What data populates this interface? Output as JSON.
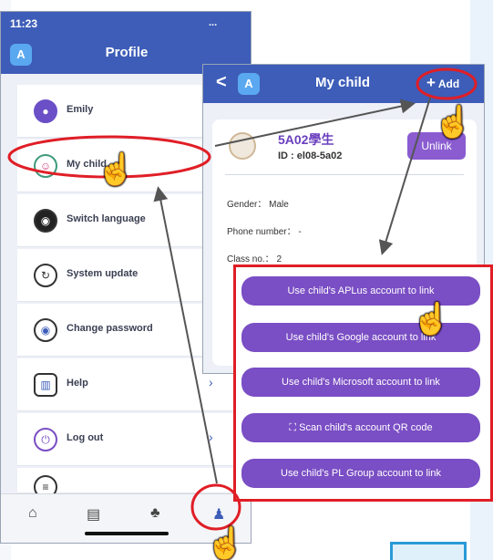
{
  "status_bar": {
    "time": "11:23",
    "signal": "..."
  },
  "profile": {
    "title": "Profile",
    "menu": [
      {
        "label": "Emily",
        "icon": "user-icon"
      },
      {
        "label": "My child",
        "icon": "child-icon"
      },
      {
        "label": "Switch language",
        "icon": "globe-icon"
      },
      {
        "label": "System update",
        "icon": "refresh-icon"
      },
      {
        "label": "Change password",
        "icon": "eye-icon"
      },
      {
        "label": "Help",
        "icon": "chart-icon"
      },
      {
        "label": "Log out",
        "icon": "power-icon"
      }
    ],
    "tabs": [
      "home-icon",
      "list-icon",
      "bell-icon",
      "person-icon"
    ]
  },
  "my_child": {
    "title": "My child",
    "back": "<",
    "add_label": "Add",
    "child": {
      "name": "5A02學生",
      "id": "ID : el08-5a02"
    },
    "unlink_label": "Unlink",
    "gender": "Gender： Male",
    "phone": "Phone number： -",
    "class_no": "Class no.： 2"
  },
  "link_options": [
    "Use child's APLus account to link",
    "Use child's Google account to link",
    "Use child's Microsoft account to link",
    "Scan child's account QR code",
    "Use child's PL Group account to link"
  ],
  "colors": {
    "header": "#3d5db8",
    "accent": "#7a4ec4",
    "highlight": "#e01e26"
  }
}
